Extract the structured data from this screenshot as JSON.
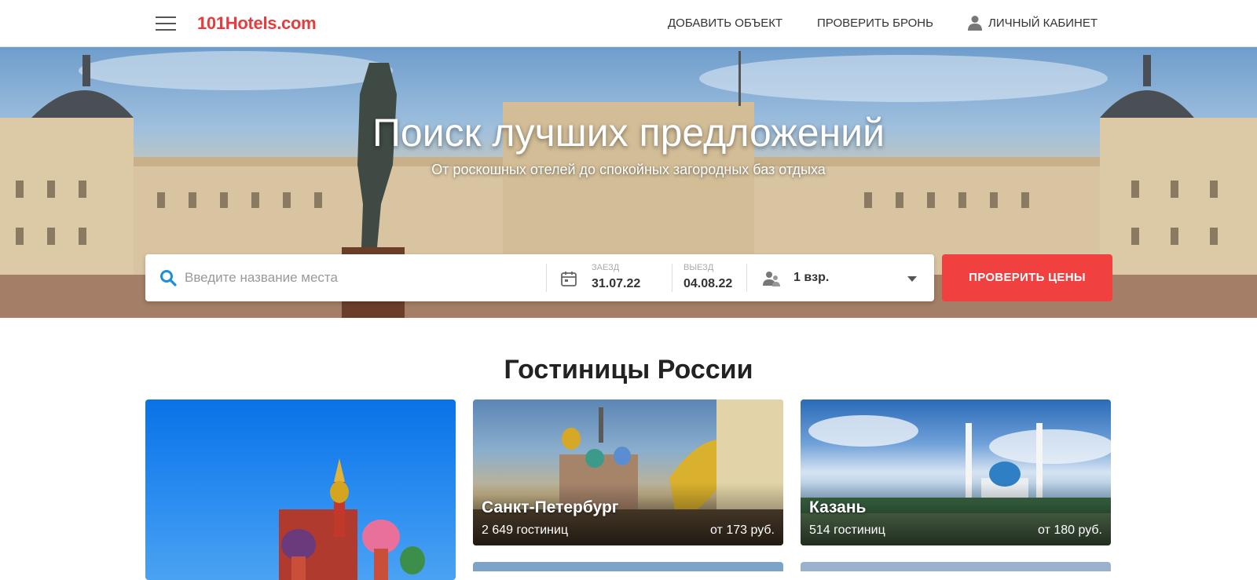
{
  "header": {
    "logo": "101Hotels.com",
    "nav_add_property": "ДОБАВИТЬ ОБЪЕКТ",
    "nav_check_booking": "ПРОВЕРИТЬ БРОНЬ",
    "nav_account": "ЛИЧНЫЙ КАБИНЕТ"
  },
  "hero": {
    "title": "Поиск лучших предложений",
    "subtitle": "От роскошных отелей до спокойных загородных баз отдыха"
  },
  "search": {
    "placeholder": "Введите название места",
    "checkin_label": "ЗАЕЗД",
    "checkin_value": "31.07.22",
    "checkout_label": "ВЫЕЗД",
    "checkout_value": "04.08.22",
    "guests_value": "1 взр.",
    "submit_label": "ПРОВЕРИТЬ ЦЕНЫ"
  },
  "section": {
    "title": "Гостиницы России"
  },
  "cities": [
    {
      "name": "",
      "count": "",
      "price": ""
    },
    {
      "name": "Санкт-Петербург",
      "count": "2 649 гостиниц",
      "price": "от 173 руб."
    },
    {
      "name": "Казань",
      "count": "514 гостиниц",
      "price": "от 180 руб."
    }
  ],
  "colors": {
    "accent": "#f0403f",
    "logo": "#e53d3d",
    "search_icon": "#1e8fd6"
  },
  "icons": {
    "menu": "hamburger-menu-icon",
    "account": "user-icon",
    "search": "search-icon",
    "calendar": "calendar-icon",
    "guests": "guests-icon",
    "dropdown": "caret-down-icon"
  }
}
